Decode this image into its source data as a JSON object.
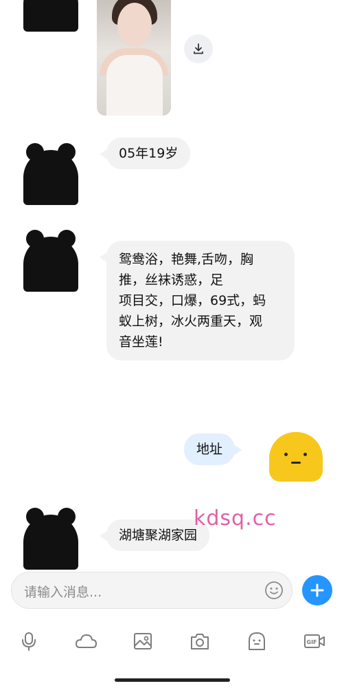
{
  "messages": {
    "age": "05年19岁",
    "services_line1": "鸳鸯浴，艳舞,舌吻，胸",
    "services_line2": "推，丝袜诱惑，足",
    "services_line3": "项目交，口爆，69式，蚂",
    "services_line4": "蚁上树，冰火两重天，观",
    "services_line5": "音坐莲!",
    "outgoing_address": "地址",
    "address_reply": "湖塘聚湖家园"
  },
  "watermark": "kdsq.cc",
  "composer": {
    "placeholder": "请输入消息..."
  },
  "toolbar": {
    "icons": [
      "microphone-icon",
      "cloud-icon",
      "image-icon",
      "camera-icon",
      "emoji-icon",
      "gif-icon"
    ]
  },
  "colors": {
    "incoming_bubble": "#f2f2f2",
    "outgoing_bubble": "#e1efff",
    "accent_blue": "#2595ff",
    "watermark": "#e060a8"
  }
}
